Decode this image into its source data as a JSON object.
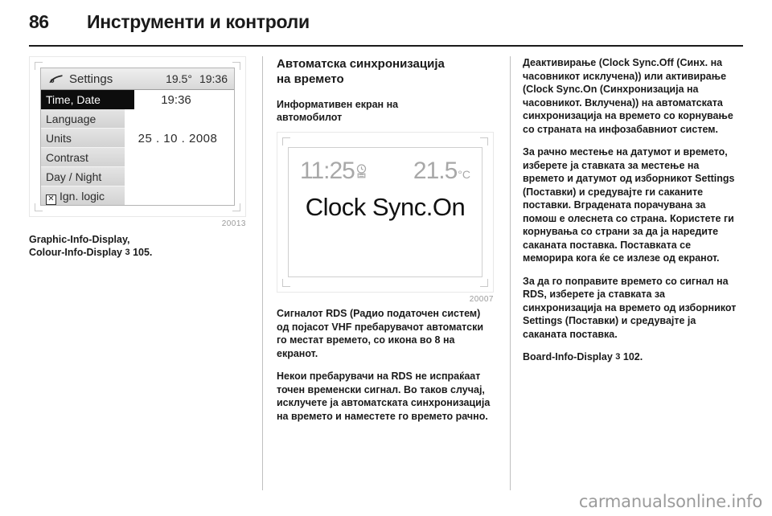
{
  "header": {
    "page_number": "86",
    "title": "Инструменти и контроли"
  },
  "figure_settings": {
    "figure_number": "20013",
    "title_icon": "wrench-icon",
    "title": "Settings",
    "status_temp": "19.5°",
    "status_time": "19:36",
    "menu_items": [
      {
        "label": "Time, Date",
        "selected": true,
        "checkbox": false
      },
      {
        "label": "Language",
        "selected": false,
        "checkbox": false
      },
      {
        "label": "Units",
        "selected": false,
        "checkbox": false
      },
      {
        "label": "Contrast",
        "selected": false,
        "checkbox": false
      },
      {
        "label": "Day / Night",
        "selected": false,
        "checkbox": false
      },
      {
        "label": "Ign. logic",
        "selected": false,
        "checkbox": true,
        "checkbox_mark": "✕"
      }
    ],
    "value_time": "19:36",
    "value_date": "25 . 10 . 2008",
    "caption_line1": "Graphic-Info-Display,",
    "caption_line2": "Colour-Info-Display",
    "caption_arrow": "3",
    "caption_page": "105."
  },
  "figure_clocksync": {
    "figure_number": "20007",
    "time": "11:25",
    "clock_icon": "rds-clock-icon",
    "temperature": "21.5",
    "temperature_unit": "°C",
    "main_text": "Clock Sync.On"
  },
  "column2": {
    "section_heading_line1": "Автоматска синхронизација",
    "section_heading_line2": "на времето",
    "subheading_line1": "Информативен екран на",
    "subheading_line2": "автомобилот",
    "paragraph1": "Сигналот RDS (Радио податочен систем) од појасот VHF пребарувачот автоматски го местат времето, со икона во 8 на екранот.",
    "paragraph2": "Некои пребарувачи на RDS не испраќаат точен временски сигнал. Во таков случај, исклучете ја автоматската синхронизација на времето и наместете го времето рачно."
  },
  "column3": {
    "paragraph1": "Деактивирање (Clock Sync.Off (Синх. на часовникот исклучена)) или активирање (Clock Sync.On (Синхронизација на часовникот. Вклучена)) на автоматската синхронизација на времето со корнување со страната на инфозабавниот систем.",
    "paragraph2": "За рачно местење на датумот и времето, изберете ја ставката за местење на времето и датумот од изборникот Settings (Поставки) и средувајте ги саканите поставки. Вградената порачувана за помош е олеснета со страна. Користете ги корнувања со страни за да ја наредите саканата поставка. Поставката се меморира кога ќе се излезе од екранот.",
    "paragraph3": "За да го поправите времето со сигнал на RDS, изберете ја ставката за синхронизација на времето од изборникот Settings (Поставки) и средувајте ја саканата поставка.",
    "reference_label": "Board-Info-Display",
    "reference_arrow": "3",
    "reference_page": "102."
  },
  "watermark": "carmanualsonline.info"
}
